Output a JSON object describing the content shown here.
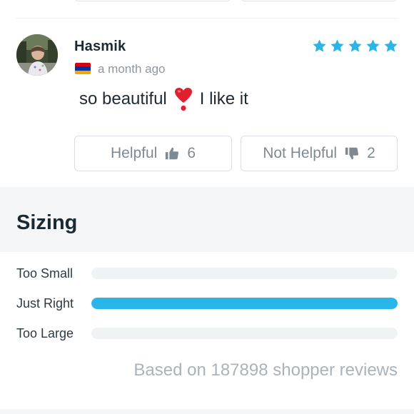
{
  "review": {
    "reviewer_name": "Hasmik",
    "country_flag_icon": "armenia-flag-icon",
    "time_ago": "a month ago",
    "rating": 5,
    "rating_max": 5,
    "star_color": "#29b5e8",
    "text_before": "so beautiful",
    "text_emoji_icon": "heavy-heart-exclamation-icon",
    "text_after": "I like it",
    "helpful_label": "Helpful",
    "helpful_icon": "thumbs-up-icon",
    "helpful_count": "6",
    "not_helpful_label": "Not Helpful",
    "not_helpful_icon": "thumbs-down-icon",
    "not_helpful_count": "2"
  },
  "sizing": {
    "title": "Sizing",
    "accent_color": "#29b5e8",
    "rows": [
      {
        "label": "Too Small",
        "fraction": 0.0
      },
      {
        "label": "Just Right",
        "fraction": 1.0
      },
      {
        "label": "Too Large",
        "fraction": 0.0
      }
    ],
    "based_on": "Based on 187898 shopper reviews"
  }
}
